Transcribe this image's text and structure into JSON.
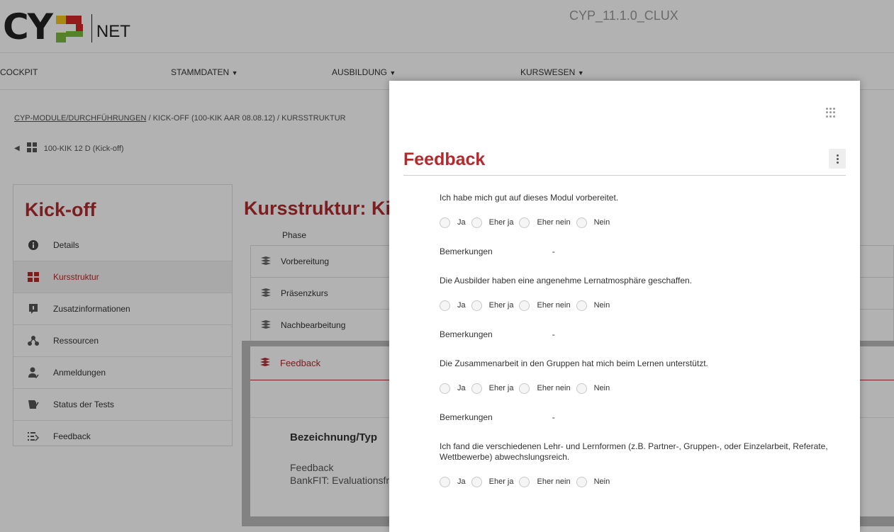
{
  "header": {
    "logo_c": "C",
    "logo_y": "Y",
    "logo_net": "NET",
    "version": "CYP_11.1.0_CLUX"
  },
  "nav": [
    {
      "label": "COCKPIT",
      "caret": false
    },
    {
      "label": "STAMMDATEN",
      "caret": true
    },
    {
      "label": "AUSBILDUNG",
      "caret": true
    },
    {
      "label": "KURSWESEN",
      "caret": true
    }
  ],
  "breadcrumb": {
    "link": "CYP-MODULE/DURCHFÜHRUNGEN",
    "rest": " /  KICK-OFF (100-KIK AAR 08.08.12)  / KURSSTRUKTUR"
  },
  "back_label": "100-KIK 12 D (Kick-off)",
  "left_panel": {
    "title": "Kick-off",
    "items": [
      {
        "label": "Details",
        "icon": "info-icon"
      },
      {
        "label": "Kursstruktur",
        "icon": "structure-icon",
        "active": true
      },
      {
        "label": "Zusatzinformationen",
        "icon": "document-icon"
      },
      {
        "label": "Ressourcen",
        "icon": "share-icon"
      },
      {
        "label": "Anmeldungen",
        "icon": "person-icon"
      },
      {
        "label": "Status der Tests",
        "icon": "test-icon"
      },
      {
        "label": "Feedback",
        "icon": "feedback-icon"
      }
    ]
  },
  "main": {
    "title": "Kursstruktur: Kick",
    "phase_label": "Phase",
    "phases": [
      "Vorbereitung",
      "Präsenzkurs",
      "Nachbearbeitung"
    ],
    "feedback": {
      "label": "Feedback",
      "col": "Bezeichnung/Typ",
      "value1": "Feedback",
      "value2": "BankFIT: Evaluationsfr"
    }
  },
  "modal": {
    "title": "Feedback",
    "remarks_label": "Bemerkungen",
    "remarks_value": "-",
    "options": [
      "Ja",
      "Eher ja",
      "Eher nein",
      "Nein"
    ],
    "questions": [
      "Ich habe mich gut auf dieses Modul vorbereitet.",
      "Die Ausbilder haben eine angenehme Lernatmosphäre geschaffen.",
      "Die Zusammenarbeit in den Gruppen hat mich beim Lernen unterstützt.",
      "Ich fand die verschiedenen Lehr- und Lernformen (z.B. Partner-, Gruppen-, oder Einzelarbeit, Referate, Wettbewerbe) abwechslungsreich."
    ]
  },
  "colors": {
    "accent": "#b22a2e",
    "logo_red": "#d6262a",
    "logo_green": "#7bb93e",
    "logo_yellow": "#f4c51b"
  }
}
